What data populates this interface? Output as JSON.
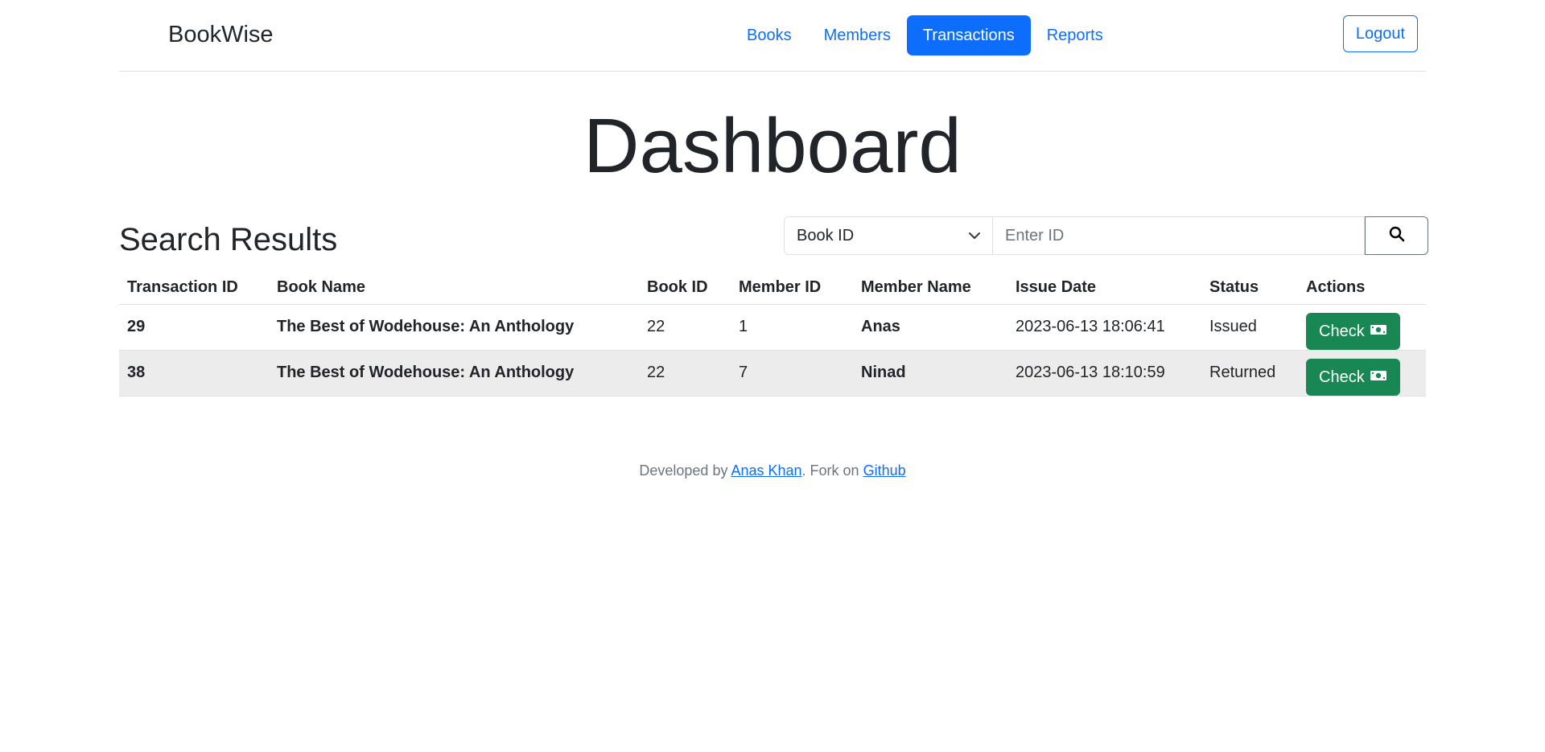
{
  "header": {
    "brand": "BookWise",
    "nav": [
      {
        "label": "Books",
        "active": false
      },
      {
        "label": "Members",
        "active": false
      },
      {
        "label": "Transactions",
        "active": true
      },
      {
        "label": "Reports",
        "active": false
      }
    ],
    "logout_label": "Logout"
  },
  "page": {
    "title": "Dashboard",
    "results_title": "Search Results"
  },
  "search": {
    "field_selected": "Book ID",
    "placeholder": "Enter ID",
    "value": ""
  },
  "table": {
    "columns": [
      "Transaction ID",
      "Book Name",
      "Book ID",
      "Member ID",
      "Member Name",
      "Issue Date",
      "Status",
      "Actions"
    ],
    "rows": [
      {
        "transaction_id": "29",
        "book_name": "The Best of Wodehouse: An Anthology",
        "book_id": "22",
        "member_id": "1",
        "member_name": "Anas",
        "issue_date": "2023-06-13 18:06:41",
        "status": "Issued",
        "action_label": "Check"
      },
      {
        "transaction_id": "38",
        "book_name": "The Best of Wodehouse: An Anthology",
        "book_id": "22",
        "member_id": "7",
        "member_name": "Ninad",
        "issue_date": "2023-06-13 18:10:59",
        "status": "Returned",
        "action_label": "Check"
      }
    ]
  },
  "footer": {
    "prefix": "Developed by ",
    "author_link": "Anas Khan",
    "middle": ". Fork on ",
    "repo_link": "Github"
  },
  "colors": {
    "primary": "#0d6efd",
    "success": "#198754",
    "stripe": "#ececec"
  },
  "icons": {
    "search": "search-icon",
    "select": "chevron-down-icon",
    "action": "money-icon"
  }
}
